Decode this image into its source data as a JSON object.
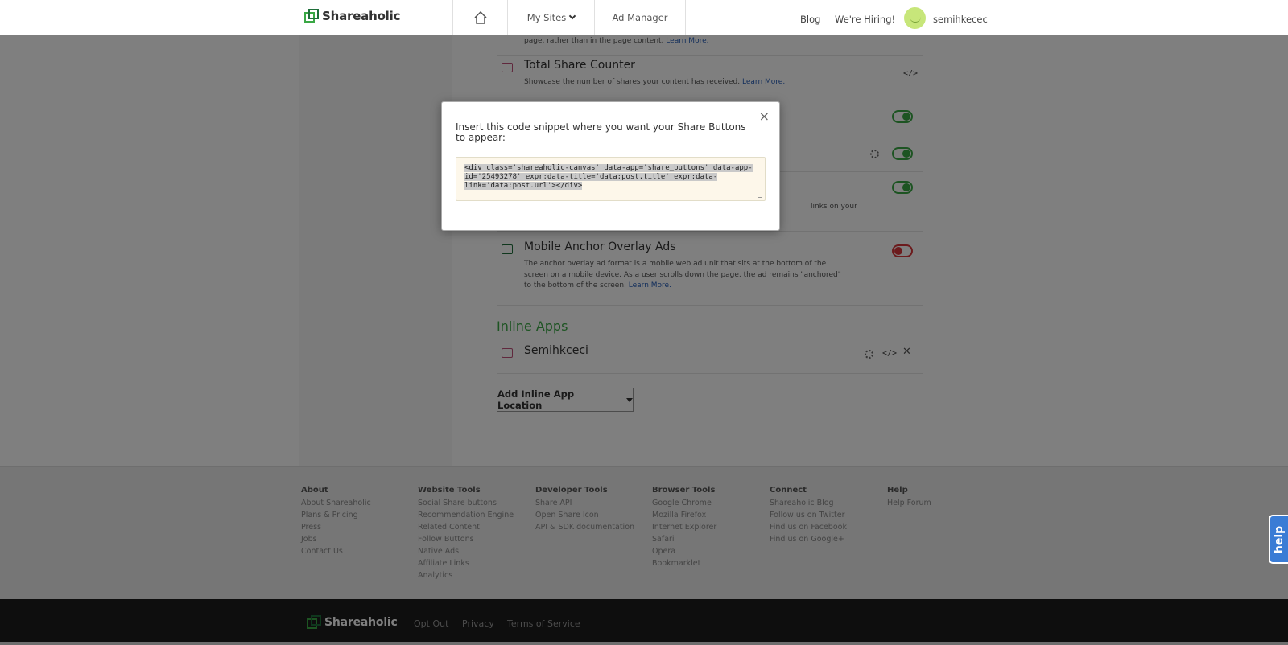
{
  "header": {
    "brand": "Shareaholic",
    "nav_sites": "My Sites",
    "nav_ad_manager": "Ad Manager",
    "blog": "Blog",
    "hiring": "We're Hiring!",
    "username": "semihkecec"
  },
  "content": {
    "truncated_desc": "page, rather than in the page content.",
    "truncated_learn": "Learn More.",
    "total_share_counter": {
      "title": "Total Share Counter",
      "desc": "Showcase the number of shares your content has received.",
      "learn": "Learn More.",
      "code_icon": "</>"
    },
    "partial_desc": "links on your",
    "mobile_anchor": {
      "title": "Mobile Anchor Overlay Ads",
      "desc": "The anchor overlay ad format is a mobile web ad unit that sits at the bottom of the screen on a mobile device. As a user scrolls down the page, the ad remains \"anchored\" to the bottom of the screen.",
      "learn": "Learn More."
    },
    "inline_apps_title": "Inline Apps",
    "inline_app": {
      "title": "Semihkceci",
      "code_icon": "</>"
    },
    "add_inline_app": "Add Inline App Location"
  },
  "footer": {
    "columns": [
      {
        "title": "About",
        "items": [
          "About Shareaholic",
          "Plans & Pricing",
          "Press",
          "Jobs",
          "Contact Us"
        ]
      },
      {
        "title": "Website Tools",
        "items": [
          "Social Share buttons",
          "Recommendation Engine",
          "Related Content",
          "Follow Buttons",
          "Native Ads",
          "Affiliate Links",
          "Analytics"
        ]
      },
      {
        "title": "Developer Tools",
        "items": [
          "Share API",
          "Open Share Icon",
          "API & SDK documentation"
        ]
      },
      {
        "title": "Browser Tools",
        "items": [
          "Google Chrome",
          "Mozilla Firefox",
          "Internet Explorer",
          "Safari",
          "Opera",
          "Bookmarklet"
        ]
      },
      {
        "title": "Connect",
        "items": [
          "Shareaholic Blog",
          "Follow us on Twitter",
          "Find us on Facebook",
          "Find us on Google+"
        ]
      },
      {
        "title": "Help",
        "items": [
          "Help Forum"
        ]
      }
    ]
  },
  "bottombar": {
    "brand": "Shareaholic",
    "opt_out": "Opt Out",
    "privacy": "Privacy",
    "terms": "Terms of Service"
  },
  "help_tab": "help",
  "modal": {
    "close": "×",
    "instructions": "Insert this code snippet where you want your Share Buttons to appear:",
    "code": "<div class='shareaholic-canvas' data-app='share_buttons' data-app-id='25493278' expr:data-title='data:post.title' expr:data-link='data:post.url'></div>"
  },
  "colors": {
    "accent_green": "#3aa845",
    "toggle_off_red": "#d9373a",
    "link_blue": "#2a60b8",
    "code_bg": "#fdf7ea",
    "help_blue": "#3a7cd5"
  },
  "icons": [
    "home-icon",
    "chevron-down-icon",
    "share-icon",
    "code-icon",
    "gear-icon",
    "close-icon",
    "list-icon"
  ]
}
